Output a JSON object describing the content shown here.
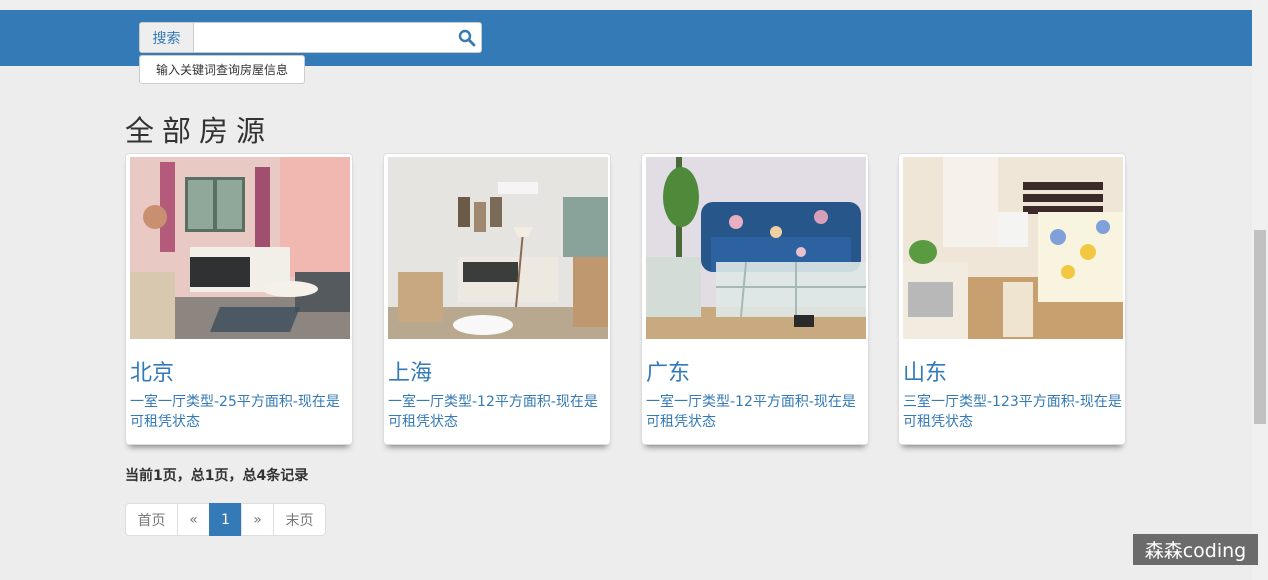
{
  "search": {
    "addon_label": "搜索",
    "value": "",
    "placeholder": "",
    "tooltip": "输入关键词查询房屋信息"
  },
  "section": {
    "title": "全部房源"
  },
  "listings": [
    {
      "city": "北京",
      "description": "一室一厅类型-25平方面积-现在是可租凭状态"
    },
    {
      "city": "上海",
      "description": "一室一厅类型-12平方面积-现在是可租凭状态"
    },
    {
      "city": "广东",
      "description": "一室一厅类型-12平方面积-现在是可租凭状态"
    },
    {
      "city": "山东",
      "description": "三室一厅类型-123平方面积-现在是可租凭状态"
    }
  ],
  "pagination": {
    "info": "当前1页，总1页，总4条记录",
    "first": "首页",
    "prev": "«",
    "current": "1",
    "next": "»",
    "last": "末页"
  },
  "watermark": "森森coding",
  "colors": {
    "primary": "#337ab7",
    "background": "#eeedee"
  },
  "icons": {
    "search": "search-icon"
  }
}
